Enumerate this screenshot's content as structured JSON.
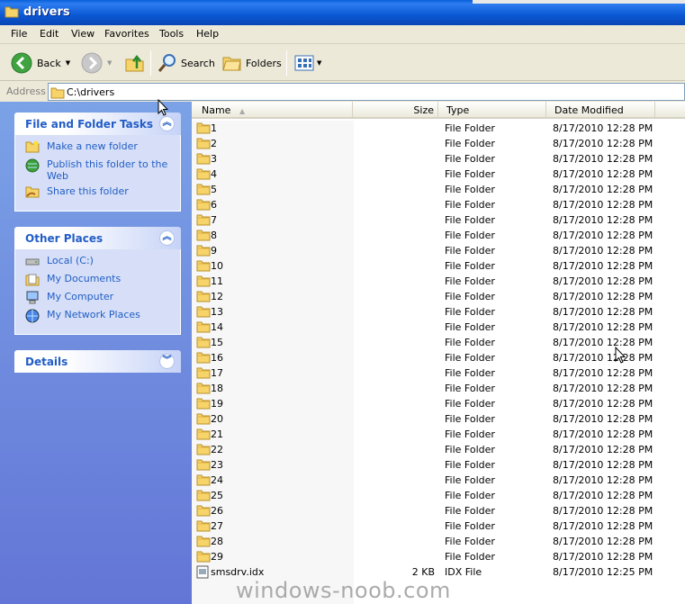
{
  "window": {
    "title": "drivers"
  },
  "menu": [
    "File",
    "Edit",
    "View",
    "Favorites",
    "Tools",
    "Help"
  ],
  "toolbar": {
    "back": "Back",
    "search": "Search",
    "folders": "Folders"
  },
  "address": {
    "label": "Address",
    "value": "C:\\drivers"
  },
  "tasks": {
    "file_folder": {
      "title": "File and Folder Tasks",
      "items": [
        "Make a new folder",
        "Publish this folder to the Web",
        "Share this folder"
      ]
    },
    "other_places": {
      "title": "Other Places",
      "items": [
        "Local (C:)",
        "My Documents",
        "My Computer",
        "My Network Places"
      ]
    },
    "details": {
      "title": "Details"
    }
  },
  "columns": {
    "name": "Name",
    "size": "Size",
    "type": "Type",
    "date": "Date Modified"
  },
  "files": [
    {
      "name": "1",
      "size": "",
      "type": "File Folder",
      "date": "8/17/2010 12:28 PM"
    },
    {
      "name": "2",
      "size": "",
      "type": "File Folder",
      "date": "8/17/2010 12:28 PM"
    },
    {
      "name": "3",
      "size": "",
      "type": "File Folder",
      "date": "8/17/2010 12:28 PM"
    },
    {
      "name": "4",
      "size": "",
      "type": "File Folder",
      "date": "8/17/2010 12:28 PM"
    },
    {
      "name": "5",
      "size": "",
      "type": "File Folder",
      "date": "8/17/2010 12:28 PM"
    },
    {
      "name": "6",
      "size": "",
      "type": "File Folder",
      "date": "8/17/2010 12:28 PM"
    },
    {
      "name": "7",
      "size": "",
      "type": "File Folder",
      "date": "8/17/2010 12:28 PM"
    },
    {
      "name": "8",
      "size": "",
      "type": "File Folder",
      "date": "8/17/2010 12:28 PM"
    },
    {
      "name": "9",
      "size": "",
      "type": "File Folder",
      "date": "8/17/2010 12:28 PM"
    },
    {
      "name": "10",
      "size": "",
      "type": "File Folder",
      "date": "8/17/2010 12:28 PM"
    },
    {
      "name": "11",
      "size": "",
      "type": "File Folder",
      "date": "8/17/2010 12:28 PM"
    },
    {
      "name": "12",
      "size": "",
      "type": "File Folder",
      "date": "8/17/2010 12:28 PM"
    },
    {
      "name": "13",
      "size": "",
      "type": "File Folder",
      "date": "8/17/2010 12:28 PM"
    },
    {
      "name": "14",
      "size": "",
      "type": "File Folder",
      "date": "8/17/2010 12:28 PM"
    },
    {
      "name": "15",
      "size": "",
      "type": "File Folder",
      "date": "8/17/2010 12:28 PM"
    },
    {
      "name": "16",
      "size": "",
      "type": "File Folder",
      "date": "8/17/2010 12:28 PM"
    },
    {
      "name": "17",
      "size": "",
      "type": "File Folder",
      "date": "8/17/2010 12:28 PM"
    },
    {
      "name": "18",
      "size": "",
      "type": "File Folder",
      "date": "8/17/2010 12:28 PM"
    },
    {
      "name": "19",
      "size": "",
      "type": "File Folder",
      "date": "8/17/2010 12:28 PM"
    },
    {
      "name": "20",
      "size": "",
      "type": "File Folder",
      "date": "8/17/2010 12:28 PM"
    },
    {
      "name": "21",
      "size": "",
      "type": "File Folder",
      "date": "8/17/2010 12:28 PM"
    },
    {
      "name": "22",
      "size": "",
      "type": "File Folder",
      "date": "8/17/2010 12:28 PM"
    },
    {
      "name": "23",
      "size": "",
      "type": "File Folder",
      "date": "8/17/2010 12:28 PM"
    },
    {
      "name": "24",
      "size": "",
      "type": "File Folder",
      "date": "8/17/2010 12:28 PM"
    },
    {
      "name": "25",
      "size": "",
      "type": "File Folder",
      "date": "8/17/2010 12:28 PM"
    },
    {
      "name": "26",
      "size": "",
      "type": "File Folder",
      "date": "8/17/2010 12:28 PM"
    },
    {
      "name": "27",
      "size": "",
      "type": "File Folder",
      "date": "8/17/2010 12:28 PM"
    },
    {
      "name": "28",
      "size": "",
      "type": "File Folder",
      "date": "8/17/2010 12:28 PM"
    },
    {
      "name": "29",
      "size": "",
      "type": "File Folder",
      "date": "8/17/2010 12:28 PM"
    },
    {
      "name": "smsdrv.idx",
      "size": "2 KB",
      "type": "IDX File",
      "date": "8/17/2010 12:25 PM",
      "icon": "file-icon"
    }
  ],
  "watermark": "windows-noob.com",
  "colors": {
    "title_bar": "#0b58d4",
    "task_link": "#215dc6",
    "task_pane": "#6f8fe0"
  }
}
